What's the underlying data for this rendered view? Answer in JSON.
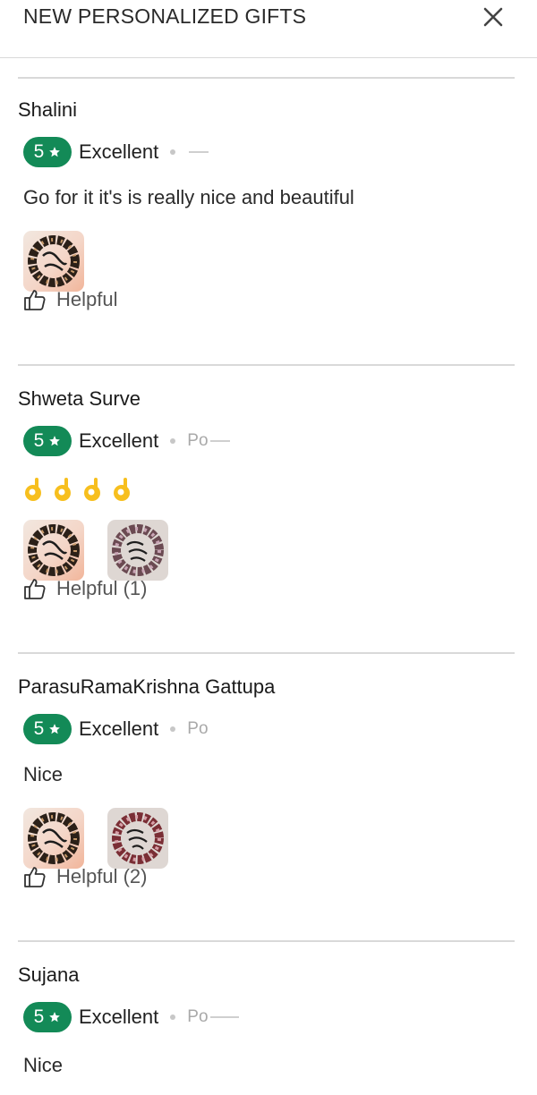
{
  "header": {
    "title": "NEW PERSONALIZED GIFTS"
  },
  "reviews": [
    {
      "name": "Shalini",
      "rating": "5",
      "rating_label": "Excellent",
      "posted": "",
      "text": "Go for it it's is really nice and beautiful",
      "helpful": "Helpful"
    },
    {
      "name": "Shweta Surve",
      "rating": "5",
      "rating_label": "Excellent",
      "posted": "Po",
      "emoji": [
        "👌",
        "👌",
        "👌",
        "👌"
      ],
      "helpful": "Helpful (1)"
    },
    {
      "name": "ParasuRamaKrishna Gattupa",
      "rating": "5",
      "rating_label": "Excellent",
      "posted": "Po",
      "text": "Nice",
      "helpful": "Helpful (2)"
    },
    {
      "name": "Sujana",
      "rating": "5",
      "rating_label": "Excellent",
      "posted": "Po",
      "text": "Nice"
    }
  ],
  "colors": {
    "rating_badge": "#138a57",
    "divider": "#d9d9d9"
  },
  "icons": {
    "close": "close-icon",
    "star": "star-icon",
    "helpful": "thumbs-up-icon"
  }
}
